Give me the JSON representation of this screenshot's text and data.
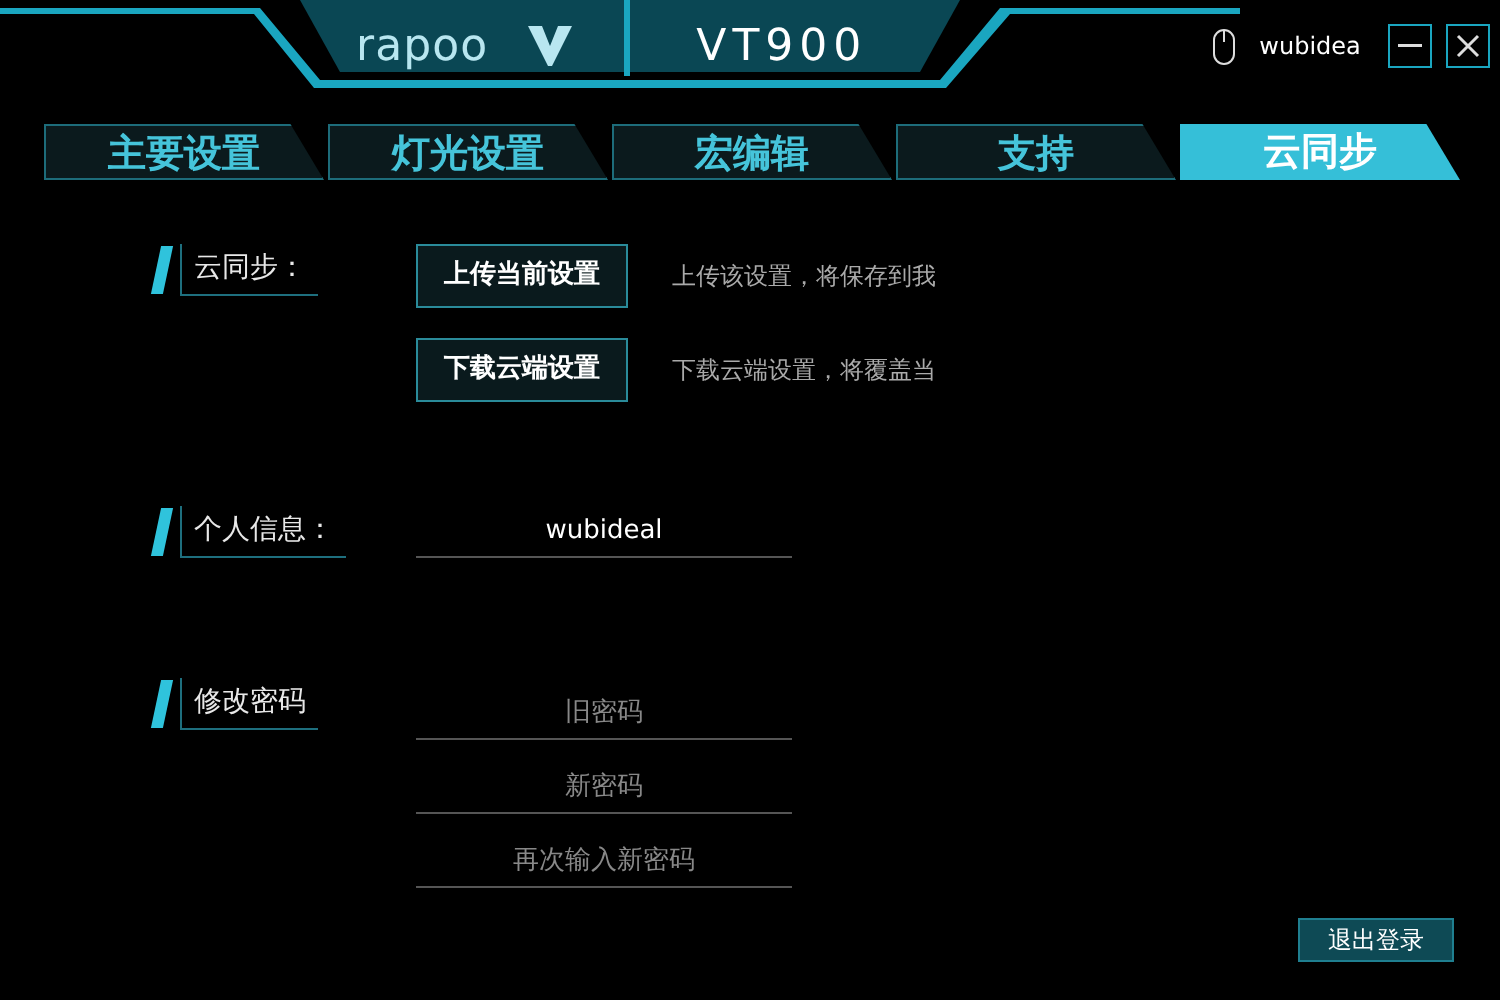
{
  "header": {
    "brand": "rapoo",
    "model": "VT900",
    "username": "wubidea"
  },
  "tabs": [
    {
      "label": "主要设置",
      "selected": false
    },
    {
      "label": "灯光设置",
      "selected": false
    },
    {
      "label": "宏编辑",
      "selected": false
    },
    {
      "label": "支持",
      "selected": false
    },
    {
      "label": "云同步",
      "selected": true
    }
  ],
  "cloud_sync": {
    "label": "云同步：",
    "actions": [
      {
        "button": "上传当前设置",
        "description": "上传该设置，将保存到我"
      },
      {
        "button": "下载云端设置",
        "description": "下载云端设置，将覆盖当"
      }
    ]
  },
  "profile": {
    "label": "个人信息：",
    "username": "wubideal"
  },
  "password": {
    "label": "修改密码",
    "fields": [
      {
        "placeholder": "旧密码"
      },
      {
        "placeholder": "新密码"
      },
      {
        "placeholder": "再次输入新密码"
      }
    ]
  },
  "logout_button": "退出登录"
}
